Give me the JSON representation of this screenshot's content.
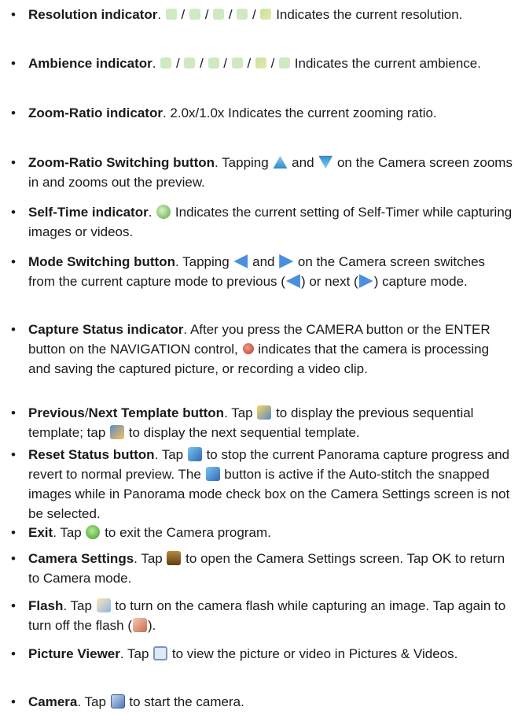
{
  "bullet": "•",
  "items": [
    {
      "term": "Resolution indicator",
      "sep": ". ",
      "icons": [
        "resolution-icon-1",
        "resolution-icon-2",
        "resolution-icon-3",
        "resolution-icon-4",
        "resolution-icon-5"
      ],
      "slash": " / ",
      "desc": " Indicates the current resolution."
    },
    {
      "term": "Ambience indicator",
      "sep": ". ",
      "icons": [
        "ambience-icon-1",
        "ambience-icon-2",
        "ambience-icon-3",
        "ambience-icon-4",
        "ambience-icon-5",
        "ambience-icon-6"
      ],
      "slash": " / ",
      "desc": " Indicates the current ambience."
    },
    {
      "term": "Zoom-Ratio indicator",
      "sep": ". ",
      "desc": "2.0x/1.0x Indicates the current zooming ratio."
    },
    {
      "term": "Zoom-Ratio Switching button",
      "sep": ". ",
      "p1": "Tapping ",
      "p2": " and ",
      "p3": " on the Camera screen zooms in and zooms out the preview."
    },
    {
      "term": "Self-Time indicator",
      "sep": ". ",
      "desc": " Indicates the current setting of Self-Timer while capturing images or videos."
    },
    {
      "term": "Mode Switching button",
      "sep": ". ",
      "p1": "Tapping ",
      "p2": " and ",
      "p3": " on the Camera screen switches from the current capture mode to previous (",
      "p4": ") or next (",
      "p5": ") capture mode."
    },
    {
      "term": "Capture Status indicator",
      "sep": ". ",
      "p1": "After you press the CAMERA button or the ENTER button on the NAVIGATION control, ",
      "p2": " indicates that the camera is processing and saving the captured picture, or recording a video clip."
    },
    {
      "term1": "Previous",
      "slash": "/",
      "term2": "Next Template button",
      "sep": ". ",
      "p1": "Tap ",
      "p2": " to display the previous sequential template; tap ",
      "p3": " to display the next sequential template."
    },
    {
      "term": "Reset Status button",
      "sep": ". ",
      "p1": "Tap ",
      "p2": " to stop the current Panorama capture progress and revert to normal preview. The ",
      "p3": " button is active if the Auto-stitch the snapped images while in Panorama mode check box on the Camera Settings screen is not be selected."
    },
    {
      "term": "Exit",
      "sep": ". ",
      "p1": "Tap ",
      "p2": " to exit the Camera program."
    },
    {
      "term": "Camera Settings",
      "sep": ". ",
      "p1": "Tap ",
      "p2": " to open the Camera Settings screen. Tap OK to return to Camera mode."
    },
    {
      "term": "Flash",
      "sep": ". ",
      "p1": "Tap ",
      "p2": " to turn on the camera flash while capturing an image. Tap again to turn off the flash (",
      "p3": ")."
    },
    {
      "term": "Picture Viewer",
      "sep": ". ",
      "p1": "Tap ",
      "p2": " to view the picture or video in Pictures & Videos."
    },
    {
      "term": "Camera",
      "sep": ". ",
      "p1": "Tap ",
      "p2": " to start the camera."
    }
  ]
}
